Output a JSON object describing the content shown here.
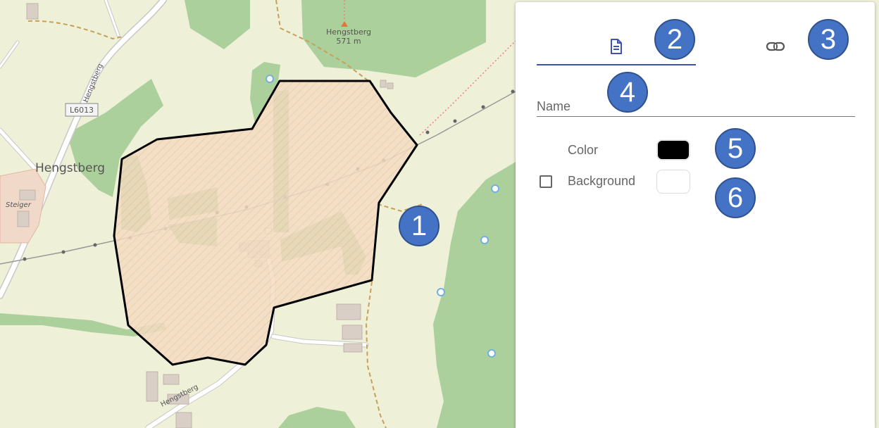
{
  "map": {
    "labels": {
      "village": "Hengstberg",
      "peak_name": "Hengstberg",
      "peak_elevation": "571 m",
      "road_code": "L6013",
      "road_left": "Hengstberg",
      "road_bottom": "Hengstberg",
      "farm": "Steiger"
    }
  },
  "panel": {
    "tabs": [
      {
        "icon": "document-icon",
        "active": true
      },
      {
        "icon": "link-icon",
        "active": false
      }
    ],
    "name_placeholder": "Name",
    "color_label": "Color",
    "color_value": "#000000",
    "background_label": "Background",
    "background_value": "#ffffff",
    "background_checked": false,
    "accent": "#3f51b5"
  },
  "callouts": [
    "1",
    "2",
    "3",
    "4",
    "5",
    "6"
  ],
  "colors": {
    "callout_fill": "#4472c4",
    "polygon_fill": "#f4dcc2",
    "polygon_stroke": "#000000",
    "forest": "#acd09c",
    "map_bg": "#eef0d8"
  }
}
